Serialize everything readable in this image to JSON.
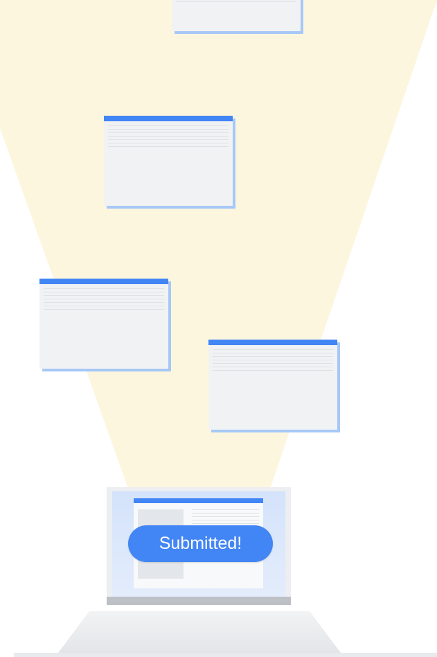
{
  "status_pill": {
    "label": "Submitted!"
  },
  "colors": {
    "beam": "#fdf6df",
    "window_titlebar": "#4285f4",
    "window_body": "#f1f2f4",
    "window_shadow": "#a6c8f7",
    "pill": "#4285f4"
  },
  "icons": {
    "floating_windows": "document-window-icon",
    "device": "laptop-icon"
  }
}
